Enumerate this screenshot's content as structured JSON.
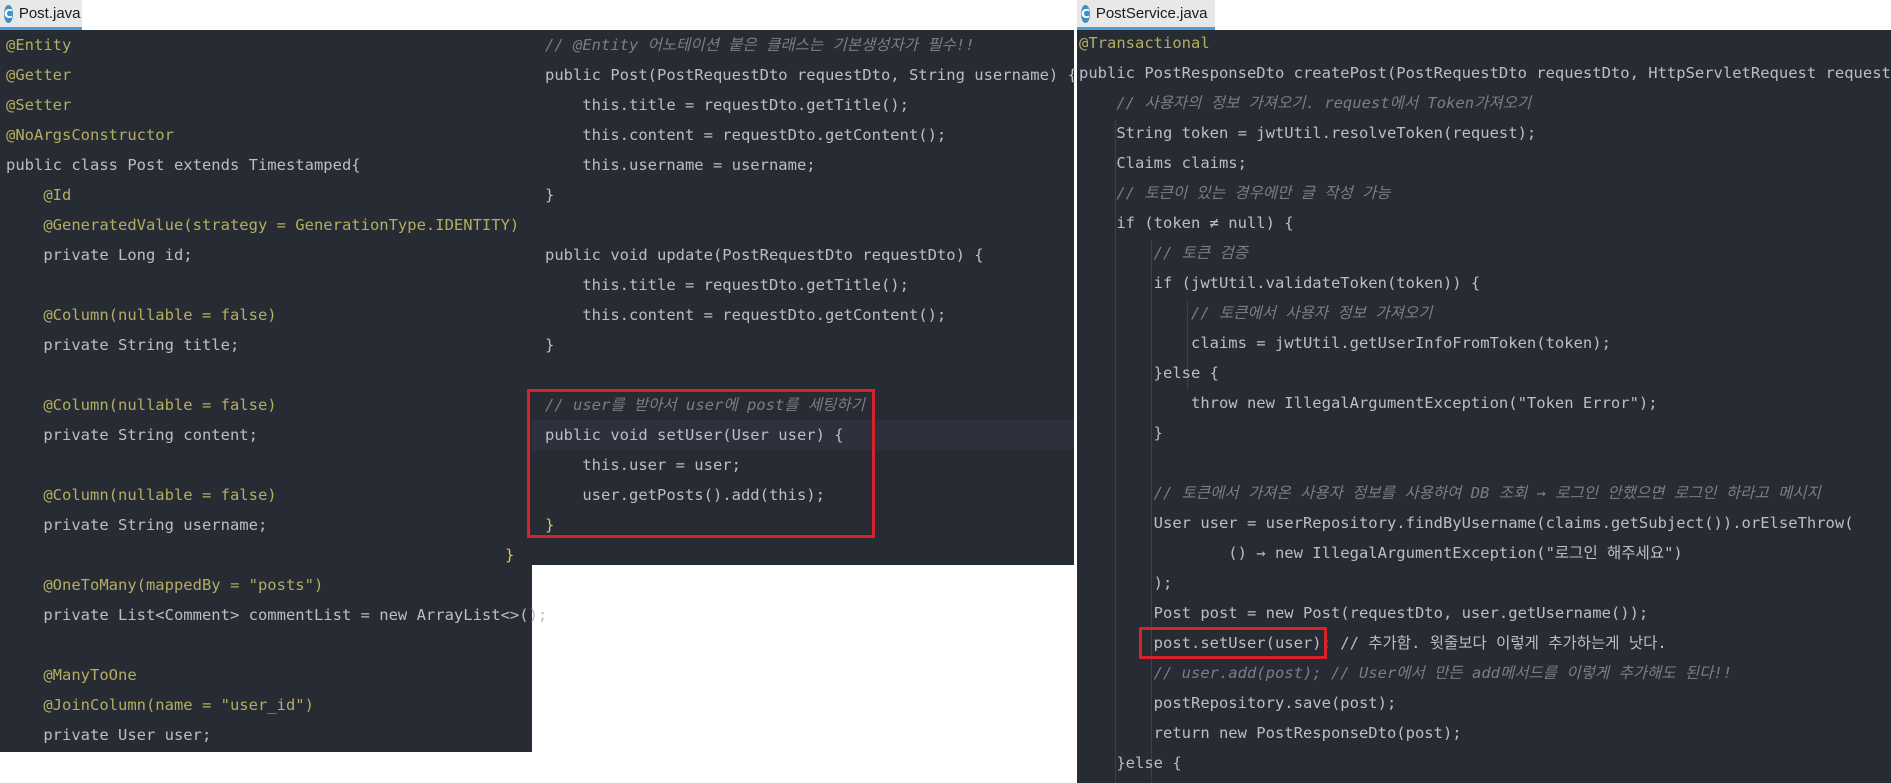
{
  "tabs": {
    "left": "Post.java",
    "right": "PostService.java"
  },
  "file_icon_letter": "C",
  "post_left": [
    "@Entity",
    "@Getter",
    "@Setter",
    "@NoArgsConstructor",
    "public class Post extends Timestamped{",
    "    @Id",
    "    @GeneratedValue(strategy = GenerationType.IDENTITY)",
    "    private Long id;",
    "",
    "    @Column(nullable = false)",
    "    private String title;",
    "",
    "    @Column(nullable = false)",
    "    private String content;",
    "",
    "    @Column(nullable = false)",
    "    private String username;",
    "",
    "    @OneToMany(mappedBy = \"posts\")",
    "    private List<Comment> commentList = new ArrayList<>();",
    "",
    "    @ManyToOne",
    "    @JoinColumn(name = \"user_id\")",
    "    private User user;"
  ],
  "post_right": [
    "// @Entity 어노테이션 붙은 클래스는 기본생성자가 필수!!",
    "public Post(PostRequestDto requestDto, String username) {",
    "    this.title = requestDto.getTitle();",
    "    this.content = requestDto.getContent();",
    "    this.username = username;",
    "}",
    "",
    "public void update(PostRequestDto requestDto) {",
    "    this.title = requestDto.getTitle();",
    "    this.content = requestDto.getContent();",
    "}",
    "",
    "// user를 받아서 user에 post를 세팅하기",
    "public void setUser(User user) {",
    "    this.user = user;",
    "    user.getPosts().add(this);",
    "}",
    "}"
  ],
  "service": [
    "@Transactional",
    "public PostResponseDto createPost(PostRequestDto requestDto, HttpServletRequest request) {",
    "    // 사용자의 정보 가져오기. request에서 Token가져오기",
    "    String token = jwtUtil.resolveToken(request);",
    "    Claims claims;",
    "    // 토큰이 있는 경우에만 글 작성 가능",
    "    if (token ≠ null) {",
    "        // 토큰 검증",
    "        if (jwtUtil.validateToken(token)) {",
    "            // 토큰에서 사용자 정보 가져오기",
    "            claims = jwtUtil.getUserInfoFromToken(token);",
    "        }else {",
    "            throw new IllegalArgumentException(\"Token Error\");",
    "        }",
    "",
    "        // 토큰에서 가져온 사용자 정보를 사용하여 DB 조회 → 로그인 안했으면 로그인 하라고 메시지",
    "        User user = userRepository.findByUsername(claims.getSubject()).orElseThrow(",
    "                () → new IllegalArgumentException(\"로그인 해주세요\")",
    "        );",
    "        Post post = new Post(requestDto, user.getUsername());",
    "        post.setUser(user); // 추가함. 윗줄보다 이렇게 추가하는게 낫다.",
    "        // user.add(post); // User에서 만든 add메서드를 이렇게 추가해도 된다!!",
    "        postRepository.save(post);",
    "        return new PostResponseDto(post);",
    "    }else {"
  ]
}
